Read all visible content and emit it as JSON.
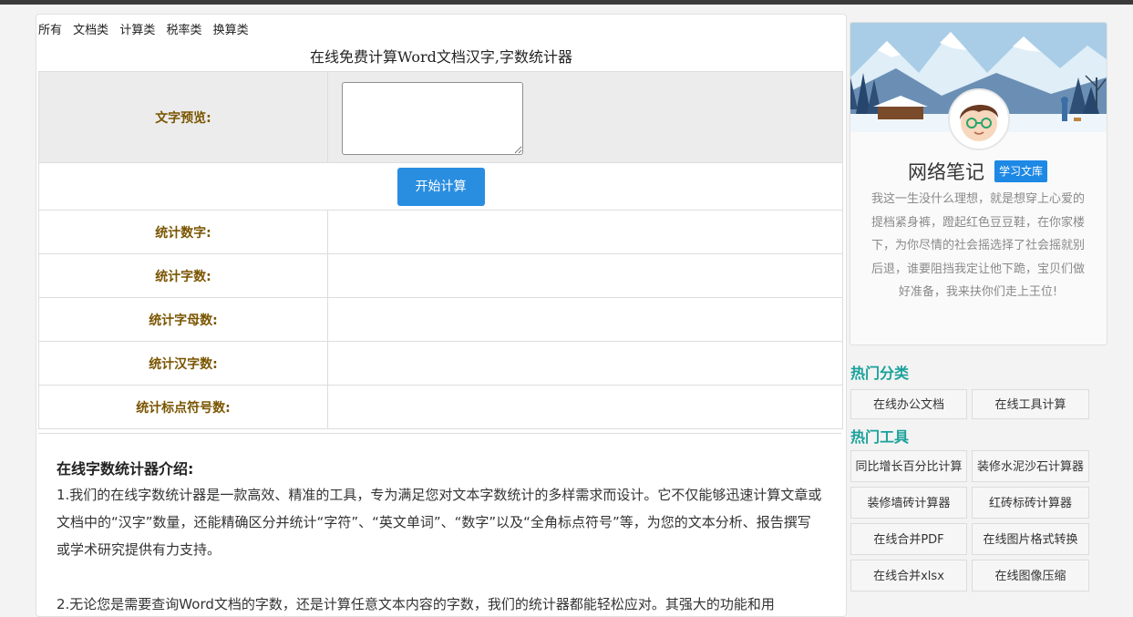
{
  "nav": [
    "所有",
    "文档类",
    "计算类",
    "税率类",
    "换算类"
  ],
  "page_title": "在线免费计算Word文档汉字,字数统计器",
  "form": {
    "preview_label": "文字预览:",
    "preview_value": "",
    "start_button": "开始计算",
    "stats": [
      {
        "label": "统计数字:",
        "value": ""
      },
      {
        "label": "统计字数:",
        "value": ""
      },
      {
        "label": "统计字母数:",
        "value": ""
      },
      {
        "label": "统计汉字数:",
        "value": ""
      },
      {
        "label": "统计标点符号数:",
        "value": ""
      }
    ]
  },
  "intro": {
    "heading": "在线字数统计器介绍:",
    "p1": "1.我们的在线字数统计器是一款高效、精准的工具，专为满足您对文本字数统计的多样需求而设计。它不仅能够迅速计算文章或文档中的“汉字”数量，还能精确区分并统计“字符”、“英文单词”、“数字”以及“全角标点符号”等，为您的文本分析、报告撰写或学术研究提供有力支持。",
    "p2": "2.无论您是需要查询Word文档的字数，还是计算任意文本内容的字数，我们的统计器都能轻松应对。其强大的功能和用"
  },
  "profile": {
    "name": "网络笔记",
    "badge": "学习文库",
    "bio": "我这一生没什么理想，就是想穿上心爱的提档紧身裤，蹬起红色豆豆鞋，在你家楼下，为你尽情的社会摇选择了社会摇就别后退，谁要阻挡我定让他下跪，宝贝们做好准备，我来扶你们走上王位!"
  },
  "hot_categories": {
    "title": "热门分类",
    "items": [
      "在线办公文档",
      "在线工具计算"
    ]
  },
  "hot_tools": {
    "title": "热门工具",
    "items": [
      "同比增长百分比计算",
      "装修水泥沙石计算器",
      "装修墙砖计算器",
      "红砖标砖计算器",
      "在线合并PDF",
      "在线图片格式转换",
      "在线合并xlsx",
      "在线图像压缩"
    ]
  },
  "colors": {
    "accent": "#2a8ee0",
    "label": "#7a5500",
    "section_title": "#1aa19a",
    "badge": "#1e88e5"
  }
}
